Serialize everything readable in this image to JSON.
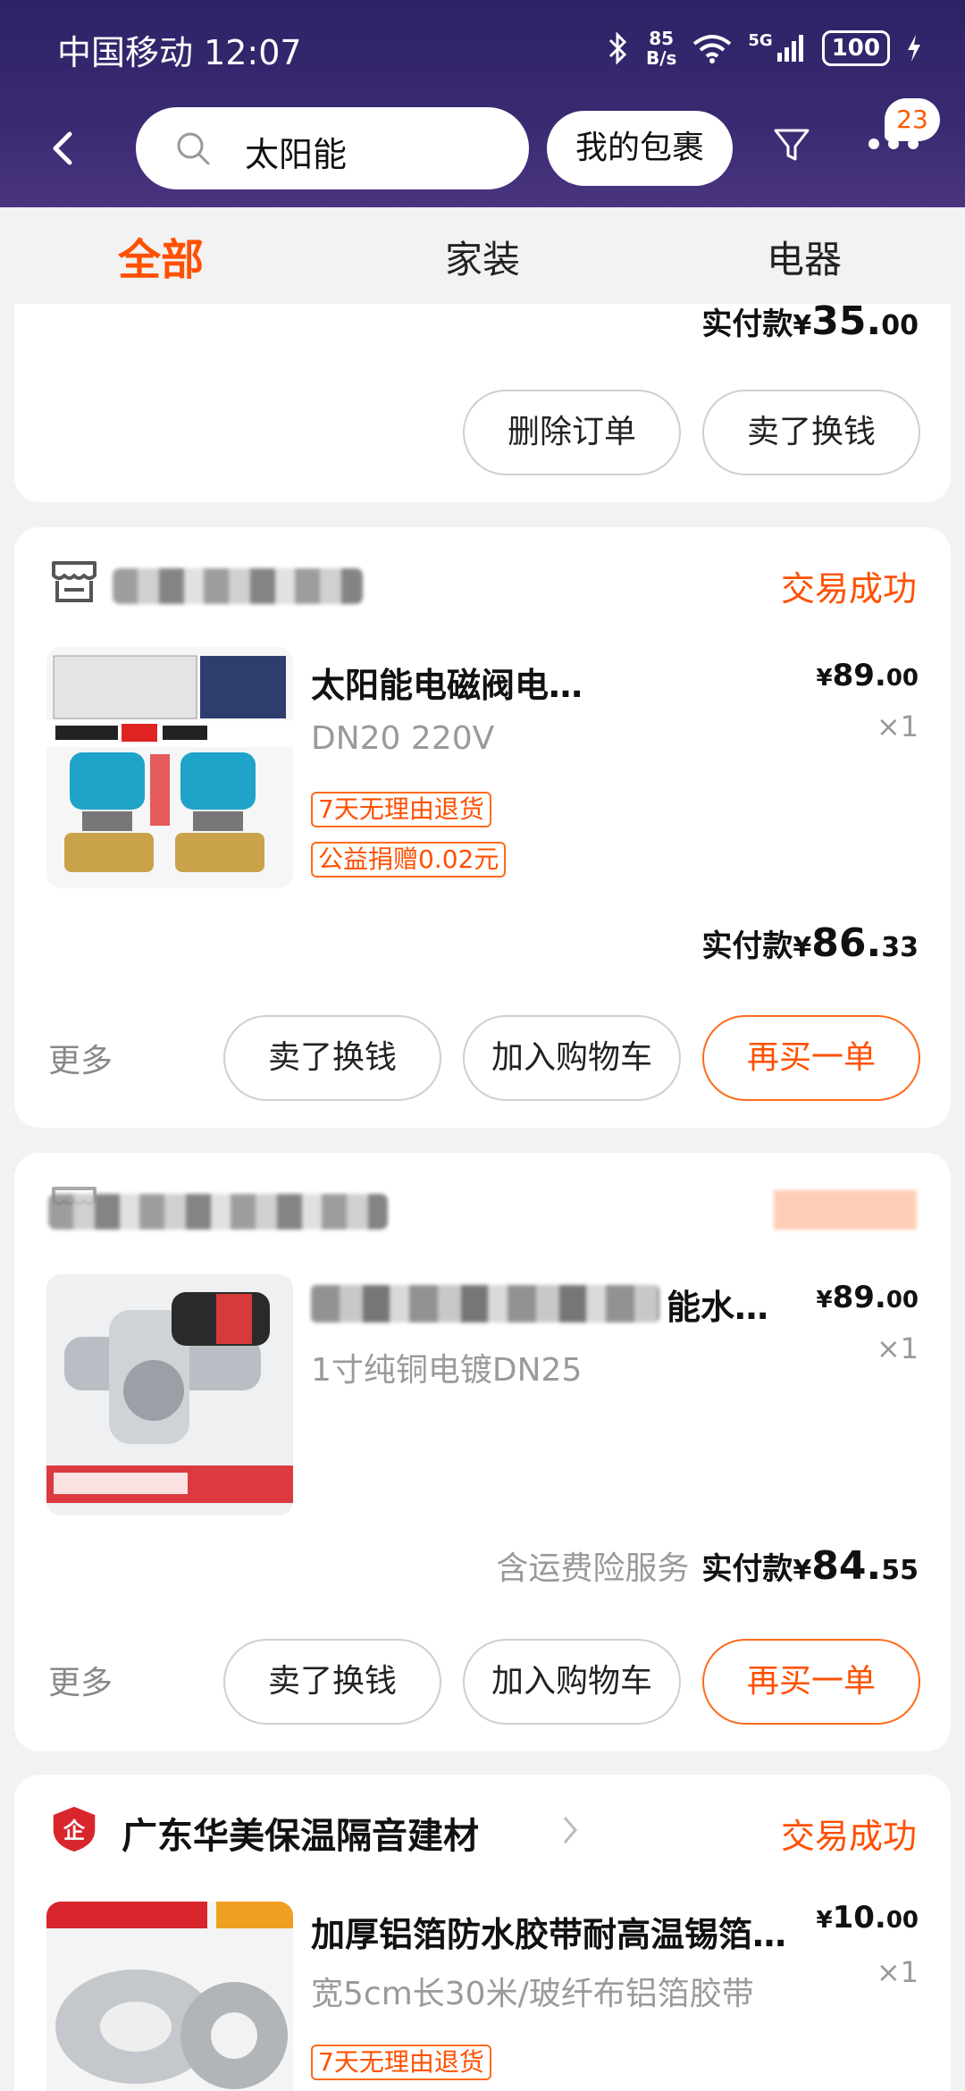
{
  "status_bar": {
    "carrier_time": "中国移动 12:07",
    "net_speed_value": "85",
    "net_speed_unit": "B/s",
    "network": "5G",
    "battery": "100"
  },
  "search": {
    "query": "太阳能",
    "package_button": "我的包裹",
    "badge_count": "23"
  },
  "tabs": [
    {
      "label": "全部"
    },
    {
      "label": "家装"
    },
    {
      "label": "电器"
    }
  ],
  "orders": [
    {
      "pay_label": "实付款",
      "pay_currency": "¥",
      "pay_int": "35.",
      "pay_dec": "00",
      "buttons": [
        "删除订单",
        "卖了换钱"
      ]
    },
    {
      "status": "交易成功",
      "title": "太阳能电磁阀电…",
      "spec": "DN20        220V",
      "price_currency": "¥",
      "price_int": "89.",
      "price_dec": "00",
      "qty": "×1",
      "tags": [
        "7天无理由退货",
        "公益捐赠0.02元"
      ],
      "pay_label": "实付款",
      "pay_currency": "¥",
      "pay_int": "86.",
      "pay_dec": "33",
      "more": "更多",
      "buttons": [
        "卖了换钱",
        "加入购物车",
        "再买一单"
      ]
    },
    {
      "title_tail": "能水…",
      "spec": "1寸纯铜电镀DN25",
      "price_currency": "¥",
      "price_int": "89.",
      "price_dec": "00",
      "qty": "×1",
      "insurance": "含运费险服务",
      "pay_label": "实付款",
      "pay_currency": "¥",
      "pay_int": "84.",
      "pay_dec": "55",
      "more": "更多",
      "buttons": [
        "卖了换钱",
        "加入购物车",
        "再买一单"
      ]
    },
    {
      "shop_name": "广东华美保温隔音建材",
      "status": "交易成功",
      "title": "加厚铝箔防水胶带耐高温锡箔…",
      "spec": "宽5cm长30米/玻纤布铝箔胶带",
      "price_currency": "¥",
      "price_int": "10.",
      "price_dec": "00",
      "qty": "×1",
      "tags": [
        "7天无理由退货"
      ]
    }
  ],
  "colors": {
    "accent": "#ff5000",
    "header": "#2e2266",
    "background": "#f2f2f2"
  }
}
